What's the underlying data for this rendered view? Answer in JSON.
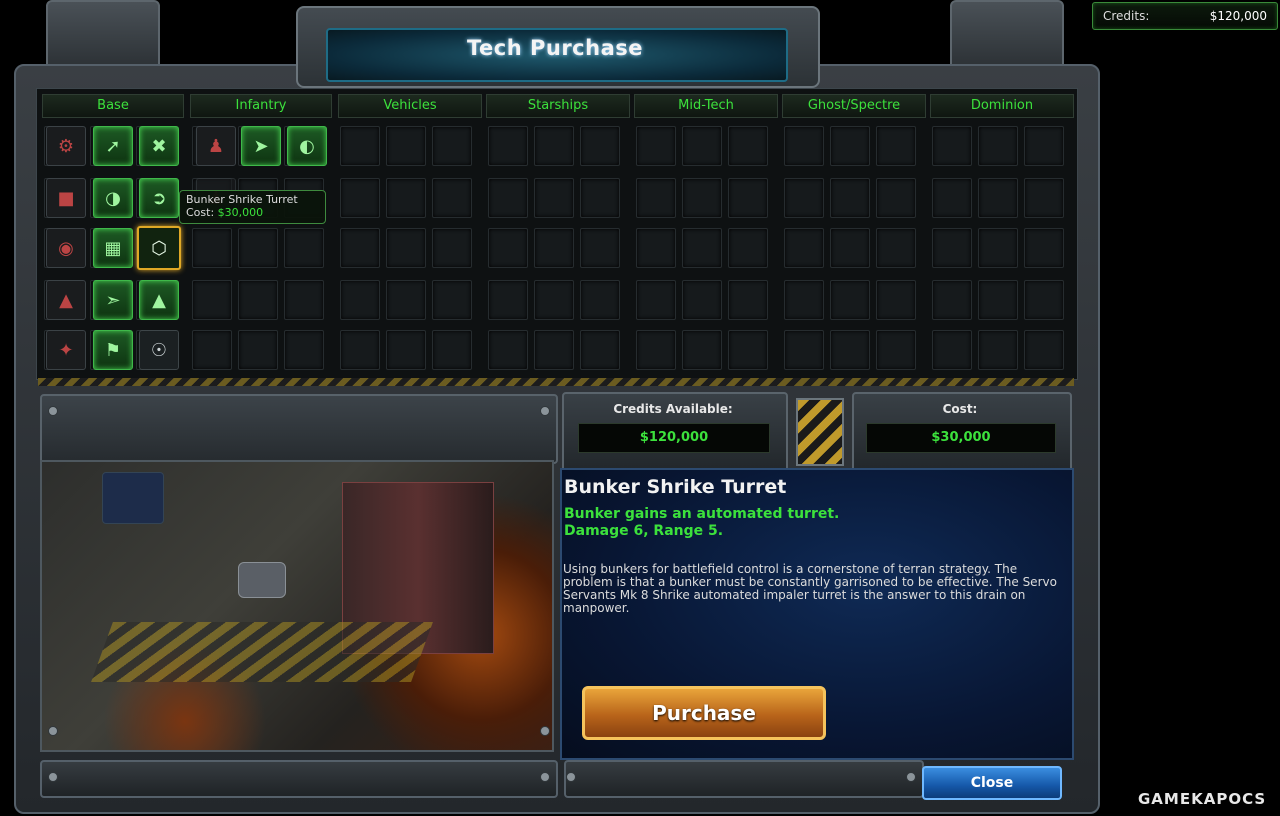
{
  "top_credits": {
    "label": "Credits:",
    "value": "$120,000"
  },
  "title": "Tech Purchase",
  "tabs": [
    "Base",
    "Infantry",
    "Vehicles",
    "Starships",
    "Mid-Tech",
    "Ghost/Spectre",
    "Dominion"
  ],
  "tooltip": {
    "name": "Bunker Shrike Turret",
    "cost_label": "Cost:",
    "cost_value": "$30,000"
  },
  "credits_available": {
    "label": "Credits Available:",
    "value": "$120,000"
  },
  "cost": {
    "label": "Cost:",
    "value": "$30,000"
  },
  "item": {
    "name": "Bunker Shrike Turret",
    "summary": "Bunker gains an automated turret.\nDamage 6, Range 5.",
    "description": "Using bunkers for battlefield control is a cornerstone of terran strategy. The problem is that a bunker must be constantly garrisoned to be effective. The Servo Servants Mk 8 Shrike automated impaler turret is the answer to this drain on manpower."
  },
  "buttons": {
    "purchase": "Purchase",
    "close": "Close"
  },
  "watermark": "GAMEKAPOCS",
  "colors": {
    "accent_green": "#3ce13c",
    "purchase_orange": "#e9a43a",
    "close_blue": "#1557a8",
    "selected_gold": "#e0a826"
  }
}
